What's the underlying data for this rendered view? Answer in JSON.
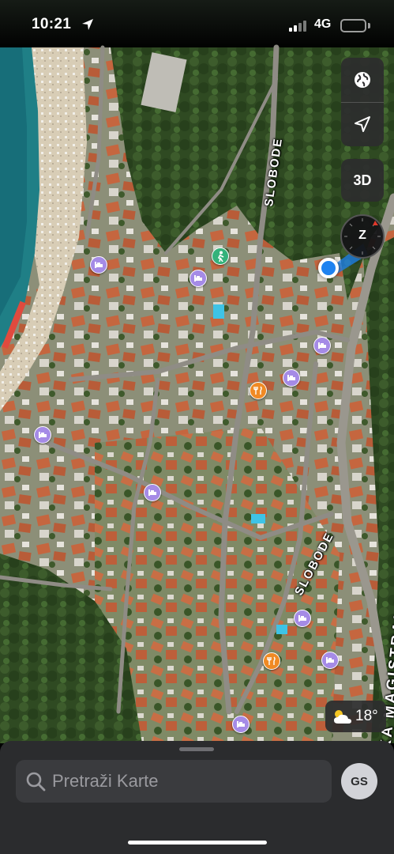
{
  "status_bar": {
    "time": "10:21",
    "network": "4G",
    "signal_bars": 4,
    "signal_bars_active": 2
  },
  "map": {
    "streets": [
      {
        "name": "SLOBODE"
      },
      {
        "name": "SLOBODE"
      },
      {
        "name": "KA MAGISTRALA"
      }
    ],
    "poi_types": [
      "hotel",
      "restaurant",
      "hiking-trail"
    ],
    "controls": {
      "map_mode_icon": "globe-icon",
      "locate_icon": "location-arrow-icon",
      "three_d_label": "3D",
      "compass_letter": "Z"
    },
    "weather": {
      "icon": "partly-sunny-icon",
      "temperature": "18°"
    }
  },
  "sheet": {
    "search_placeholder": "Pretraži Karte",
    "avatar_initials": "GS"
  },
  "colors": {
    "sea": "#1f7f86",
    "user_location": "#1e82f0",
    "hotel_pin": "#a58be6",
    "restaurant_pin": "#f08a24",
    "trail_pin": "#34b27b",
    "sheet_background": "#2b2c2e",
    "compass_north": "#e0382a"
  }
}
